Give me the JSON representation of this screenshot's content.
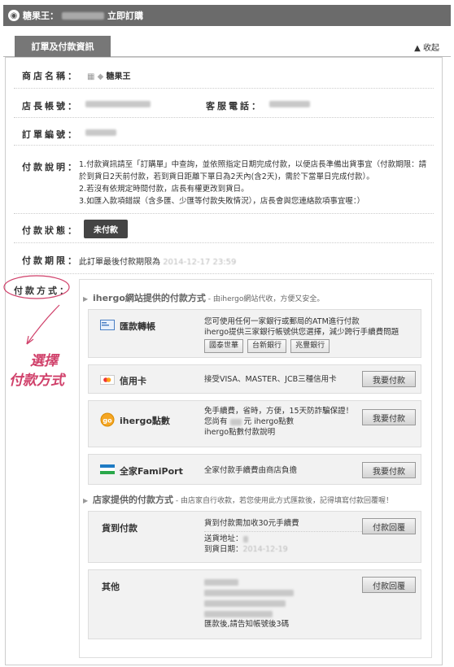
{
  "header": {
    "store_name": "糖果王：",
    "suffix": "立即訂購"
  },
  "tab": {
    "label": "訂單及付款資訊",
    "collapse": "收起"
  },
  "fields": {
    "store": {
      "label": "商店名稱：",
      "value": "糖果王"
    },
    "owner_account": {
      "label": "店長帳號："
    },
    "service_phone": {
      "label": "客服電話："
    },
    "order_no": {
      "label": "訂單編號："
    },
    "pay_desc": {
      "label": "付款說明：",
      "lines": [
        "1.付款資訊請至「訂購單」中查詢，並依照指定日期完成付款，以便店長準備出貨事宜（付款期限：請",
        "於到貨日2天前付款，若到貨日距離下單日為2天內(含2天)，需於下當單日完成付款）。",
        "2.若沒有依規定時間付款，店長有權更改到貨日。",
        "3.如匯入款項錯誤（含多匯、少匯等付款失敗情況），店長會與您連絡款項事宜喔：）"
      ]
    },
    "pay_status": {
      "label": "付款狀態：",
      "value": "未付款"
    },
    "pay_deadline": {
      "label": "付款期限：",
      "prefix": "此訂單最後付款期限為",
      "value": "2014-12-17 23:59"
    },
    "pay_method": {
      "label": "付款方式："
    }
  },
  "ihergo_section": {
    "title": "ihergo網站提供的付款方式",
    "sub": " - 由ihergo網站代收，方便又安全。"
  },
  "bank_transfer": {
    "name": "匯款轉帳",
    "desc1": "您可使用任何一家銀行或郵局的ATM進行付款",
    "desc2": "ihergo提供三家銀行帳號供您選擇，減少跨行手續費問題",
    "banks": [
      "國泰世華",
      "台新銀行",
      "兆豐銀行"
    ]
  },
  "credit_card": {
    "name": "信用卡",
    "desc": "接受VISA、MASTER、JCB三種信用卡",
    "button": "我要付款"
  },
  "ihergo_points": {
    "name": "ihergo點數",
    "desc1": "免手續費，省時，方便，15天防詐騙保證！",
    "desc2_prefix": "您尚有",
    "desc2_suffix": "元 ihergo點數",
    "desc3": "ihergo點數付款說明",
    "button": "我要付款"
  },
  "famiport": {
    "name": "全家FamiPort",
    "desc": "全家付款手續費由商店負擔",
    "button": "我要付款"
  },
  "store_section": {
    "title": "店家提供的付款方式",
    "sub": " - 由店家自行收款，若您使用此方式匯款後，記得填寫付款回覆喔！"
  },
  "cod": {
    "name": "貨到付款",
    "desc1": "貨到付款需加收30元手續費",
    "addr_label": "送貨地址：",
    "date_label": "到貨日期：",
    "date_value": "2014-12-19",
    "button": "付款回覆"
  },
  "other": {
    "name": "其他",
    "last_line": "匯款後,請告知帳號後3碼",
    "button": "付款回覆"
  },
  "annotation": {
    "line1": "選擇",
    "line2": "付款方式"
  }
}
